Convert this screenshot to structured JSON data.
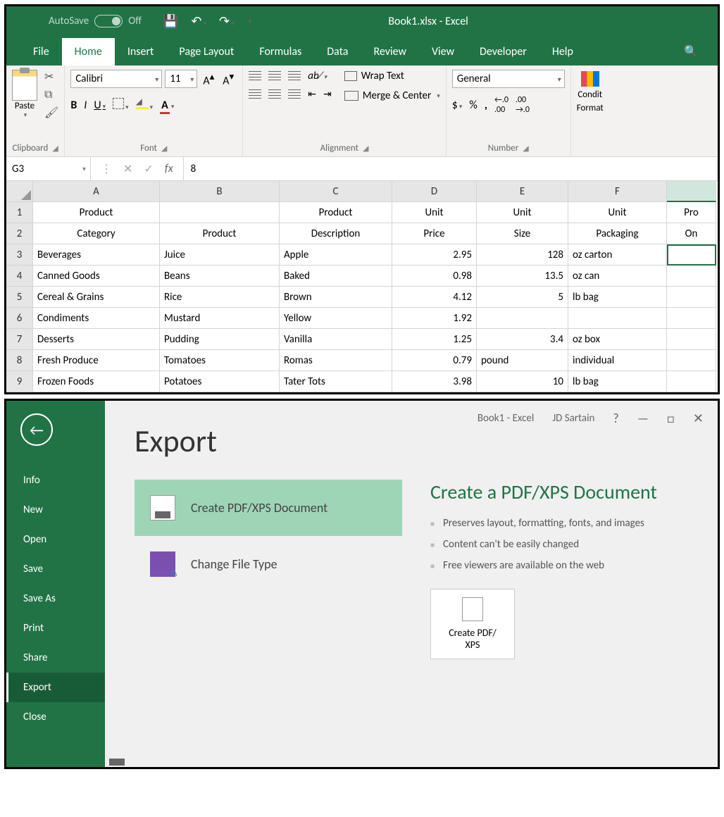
{
  "window": {
    "title": "Book1.xlsx  -  Excel",
    "autosave": {
      "label": "AutoSave",
      "state": "Off"
    }
  },
  "tabs": [
    "File",
    "Home",
    "Insert",
    "Page Layout",
    "Formulas",
    "Data",
    "Review",
    "View",
    "Developer",
    "Help"
  ],
  "ribbon": {
    "clipboard": {
      "paste": "Paste",
      "label": "Clipboard"
    },
    "font": {
      "name": "Calibri",
      "size": "11",
      "label": "Font"
    },
    "alignment": {
      "wrap": "Wrap Text",
      "merge": "Merge & Center",
      "label": "Alignment"
    },
    "number": {
      "format": "General",
      "label": "Number"
    },
    "cf": {
      "line1": "Condit",
      "line2": "Format"
    }
  },
  "formulabar": {
    "ref": "G3",
    "value": "8"
  },
  "columns": [
    "A",
    "B",
    "C",
    "D",
    "E",
    "F",
    ""
  ],
  "header1": [
    "Product",
    "",
    "Product",
    "Unit",
    "Unit",
    "Unit",
    "Pro"
  ],
  "header2": [
    "Category",
    "Product",
    "Description",
    "Price",
    "Size",
    "Packaging",
    "On"
  ],
  "rows": [
    {
      "n": "3",
      "a": "Beverages",
      "b": "Juice",
      "c": "Apple",
      "d": "2.95",
      "e": "128",
      "f": "oz carton"
    },
    {
      "n": "4",
      "a": "Canned Goods",
      "b": "Beans",
      "c": "Baked",
      "d": "0.98",
      "e": "13.5",
      "f": "oz can"
    },
    {
      "n": "5",
      "a": "Cereal & Grains",
      "b": "Rice",
      "c": "Brown",
      "d": "4.12",
      "e": "5",
      "f": "lb bag"
    },
    {
      "n": "6",
      "a": "Condiments",
      "b": "Mustard",
      "c": "Yellow",
      "d": "1.92",
      "e": "",
      "f": ""
    },
    {
      "n": "7",
      "a": "Desserts",
      "b": "Pudding",
      "c": "Vanilla",
      "d": "1.25",
      "e": "3.4",
      "f": "oz box"
    },
    {
      "n": "8",
      "a": "Fresh Produce",
      "b": "Tomatoes",
      "c": "Romas",
      "d": "0.79",
      "e": "pound",
      "f": "individual"
    },
    {
      "n": "9",
      "a": "Frozen Foods",
      "b": "Potatoes",
      "c": "Tater Tots",
      "d": "3.98",
      "e": "10",
      "f": "lb bag"
    }
  ],
  "backstage": {
    "titlebar": {
      "doc": "Book1  -  Excel",
      "user": "JD Sartain"
    },
    "menu": [
      "Info",
      "New",
      "Open",
      "Save",
      "Save As",
      "Print",
      "Share",
      "Export",
      "Close"
    ],
    "heading": "Export",
    "opts": {
      "pdf": "Create PDF/XPS Document",
      "cft": "Change File Type"
    },
    "detail": {
      "title": "Create a PDF/XPS Document",
      "b1": "Preserves layout, formatting, fonts, and images",
      "b2": "Content can't be easily changed",
      "b3": "Free viewers are available on the web",
      "btn": "Create PDF/\nXPS"
    }
  }
}
